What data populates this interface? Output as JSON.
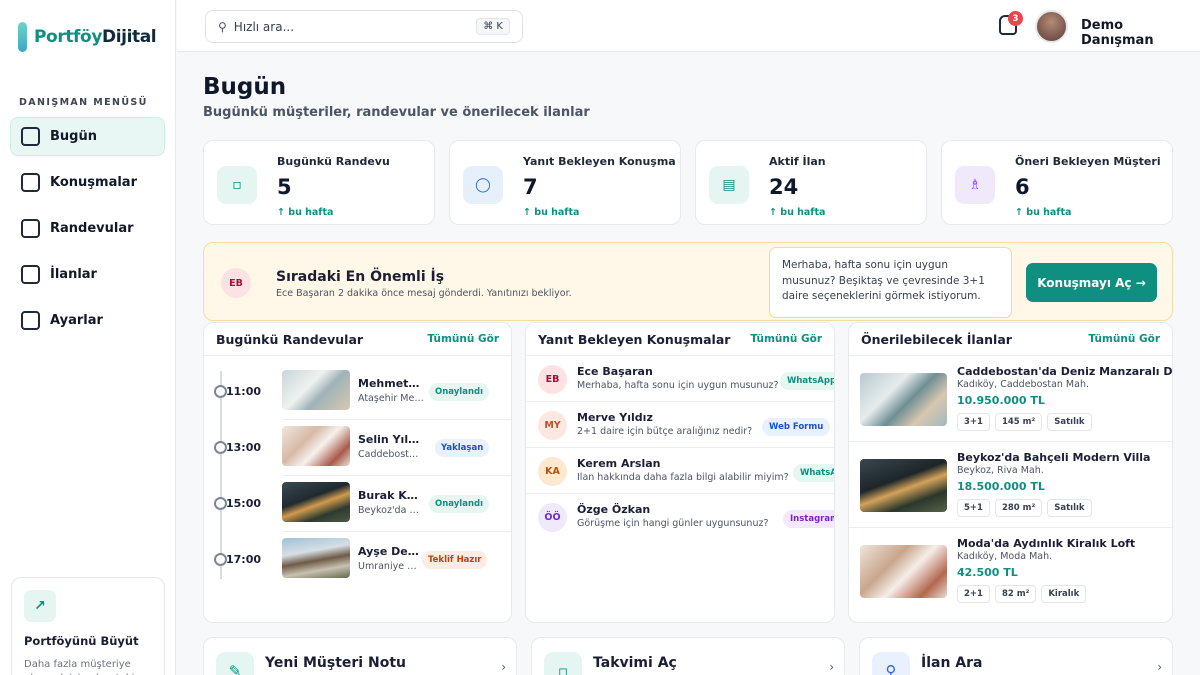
{
  "app": {
    "logo_a": "Portföy",
    "logo_b": "Dijital"
  },
  "sidebar": {
    "menu_title": "DANIŞMAN MENÜSÜ",
    "items": [
      {
        "label": "Bugün"
      },
      {
        "label": "Konuşmalar"
      },
      {
        "label": "Randevular"
      },
      {
        "label": "İlanlar"
      },
      {
        "label": "Ayarlar"
      }
    ],
    "promo": {
      "icon": "↗",
      "title": "Portföyünü Büyüt",
      "text": "Daha fazla müşteriye ulaşmak için akışı takip"
    }
  },
  "topbar": {
    "search_placeholder": "Hızlı ara...",
    "shortcut": "⌘ K",
    "notifications": "3",
    "user_name": "Demo Danışman"
  },
  "page": {
    "title": "Bugün",
    "subtitle": "Bugünkü müşteriler, randevular ve önerilecek ilanlar"
  },
  "stats": [
    {
      "label": "Bugünkü Randevu",
      "value": "5",
      "delta": "↑ bu hafta",
      "icon": "▫",
      "color": "#e5f6f2",
      "fg": "#0e8f80"
    },
    {
      "label": "Yanıt Bekleyen Konuşma",
      "value": "7",
      "delta": "↑ bu hafta",
      "icon": "◯",
      "color": "#e6f0fb",
      "fg": "#2563eb"
    },
    {
      "label": "Aktif İlan",
      "value": "24",
      "delta": "↑ bu hafta",
      "icon": "▤",
      "color": "#e5f6f2",
      "fg": "#0e8f80"
    },
    {
      "label": "Öneri Bekleyen Müşteri",
      "value": "6",
      "delta": "↑ bu hafta",
      "icon": "♗",
      "color": "#efe9fb",
      "fg": "#7c3aed"
    }
  ],
  "urgent": {
    "initials": "EB",
    "title": "Sıradaki En Önemli İş",
    "subtitle": "Ece Başaran 2 dakika önce mesaj gönderdi. Yanıtınızı bekliyor.",
    "message": "Merhaba, hafta sonu için uygun musunuz? Beşiktaş ve çevresinde 3+1 daire seçeneklerini görmek istiyorum.",
    "button": "Konuşmayı Aç →"
  },
  "appointments": {
    "title": "Bugünkü Randevular",
    "link": "Tümünü Gör",
    "items": [
      {
        "time": "11:00",
        "name": "Mehmet Kaya",
        "location": "Ataşehir Merkez",
        "status": "Onaylandı",
        "kind": "ok"
      },
      {
        "time": "13:00",
        "name": "Selin Yılmaz",
        "location": "Caddebostan Mah.",
        "status": "Yaklaşan",
        "kind": "wait"
      },
      {
        "time": "15:00",
        "name": "Burak Karaca",
        "location": "Beykoz'da Villa",
        "status": "Onaylandı",
        "kind": "ok"
      },
      {
        "time": "17:00",
        "name": "Ayşe Demir",
        "location": "Ümraniye Merkez",
        "status": "Teklif Hazır",
        "kind": "offer"
      }
    ]
  },
  "conversations": {
    "title": "Yanıt Bekleyen Konuşmalar",
    "link": "Tümünü Gör",
    "items": [
      {
        "initials": "EB",
        "name": "Ece Başaran",
        "message": "Merhaba, hafta sonu için uygun musunuz?",
        "source": "WhatsApp",
        "bg": "#fde2e4",
        "fg": "#9f1239",
        "sbg": "#e6f6f1",
        "sfg": "#0e8f80"
      },
      {
        "initials": "MY",
        "name": "Merve Yıldız",
        "message": "2+1 daire için bütçe aralığınız nedir?",
        "source": "Web Formu",
        "bg": "#fde7e1",
        "fg": "#b4532a",
        "sbg": "#e8f1fd",
        "sfg": "#1d4ed8"
      },
      {
        "initials": "KA",
        "name": "Kerem Arslan",
        "message": "İlan hakkında daha fazla bilgi alabilir miyim?",
        "source": "WhatsApp",
        "bg": "#fde9cf",
        "fg": "#b45309",
        "sbg": "#e6f6f1",
        "sfg": "#0e8f80"
      },
      {
        "initials": "ÖÖ",
        "name": "Özge Özkan",
        "message": "Görüşme için hangi günler uygunsunuz?",
        "source": "Instagram",
        "bg": "#efe9fb",
        "fg": "#6d28d9",
        "sbg": "#f3e8fd",
        "sfg": "#7e22ce"
      }
    ]
  },
  "listings": {
    "title": "Önerilebilecek İlanlar",
    "link": "Tümünü Gör",
    "items": [
      {
        "title": "Caddebostan'da Deniz Manzaralı Daire",
        "location": "Kadıköy, Caddebostan Mah.",
        "price": "10.950.000 TL",
        "tags": [
          "3+1",
          "145 m²",
          "Satılık"
        ]
      },
      {
        "title": "Beykoz'da Bahçeli Modern Villa",
        "location": "Beykoz, Riva Mah.",
        "price": "18.500.000 TL",
        "tags": [
          "5+1",
          "280 m²",
          "Satılık"
        ]
      },
      {
        "title": "Moda'da Aydınlık Kiralık Loft",
        "location": "Kadıköy, Moda Mah.",
        "price": "42.500 TL",
        "tags": [
          "2+1",
          "82 m²",
          "Kiralık"
        ]
      }
    ]
  },
  "actions": [
    {
      "label": "Yeni Müşteri Notu",
      "icon": "✎",
      "bg": "#e5f6f2",
      "fg": "#0e8f80"
    },
    {
      "label": "Takvimi Aç",
      "icon": "▫",
      "bg": "#e5f6f2",
      "fg": "#0e8f80"
    },
    {
      "label": "İlan Ara",
      "icon": "⚲",
      "bg": "#e8f1fd",
      "fg": "#2563eb"
    }
  ]
}
